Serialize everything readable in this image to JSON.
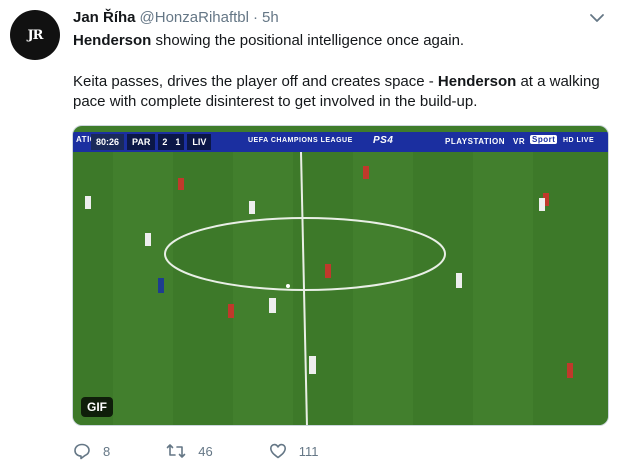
{
  "tweet": {
    "author_name": "Jan Říha",
    "handle": "@HonzaRihaftbl",
    "separator": "·",
    "time": "5h",
    "avatar_text": "JR",
    "line1_bold": "Henderson",
    "line1_rest": " showing the positional intelligence once again.",
    "line2_start": "Keita passes, drives the player off and creates space - ",
    "line2_bold": "Henderson",
    "line2_rest": " at a walking pace with complete disinterest to get involved in the build-up."
  },
  "media": {
    "clock": "80:26",
    "home_team": "PAR",
    "home_score": "2",
    "away_score": "1",
    "away_team": "LIV",
    "ad_left": "ATIO",
    "ad_ucl": "UEFA CHAMPIONS LEAGUE",
    "ad_ps4": "PS4",
    "ad_playstation": "PLAYSTATION",
    "ad_vr": "VR",
    "ad_sport": "Sport",
    "ad_hd": "HD LIVE",
    "gif_label": "GIF",
    "pitch_color": "#3e7a2a",
    "pitch_stripe": "#437f2e"
  },
  "actions": {
    "replies": "8",
    "retweets": "46",
    "likes": "111"
  },
  "colors": {
    "secondary_text": "#657786",
    "primary_text": "#14171a"
  }
}
